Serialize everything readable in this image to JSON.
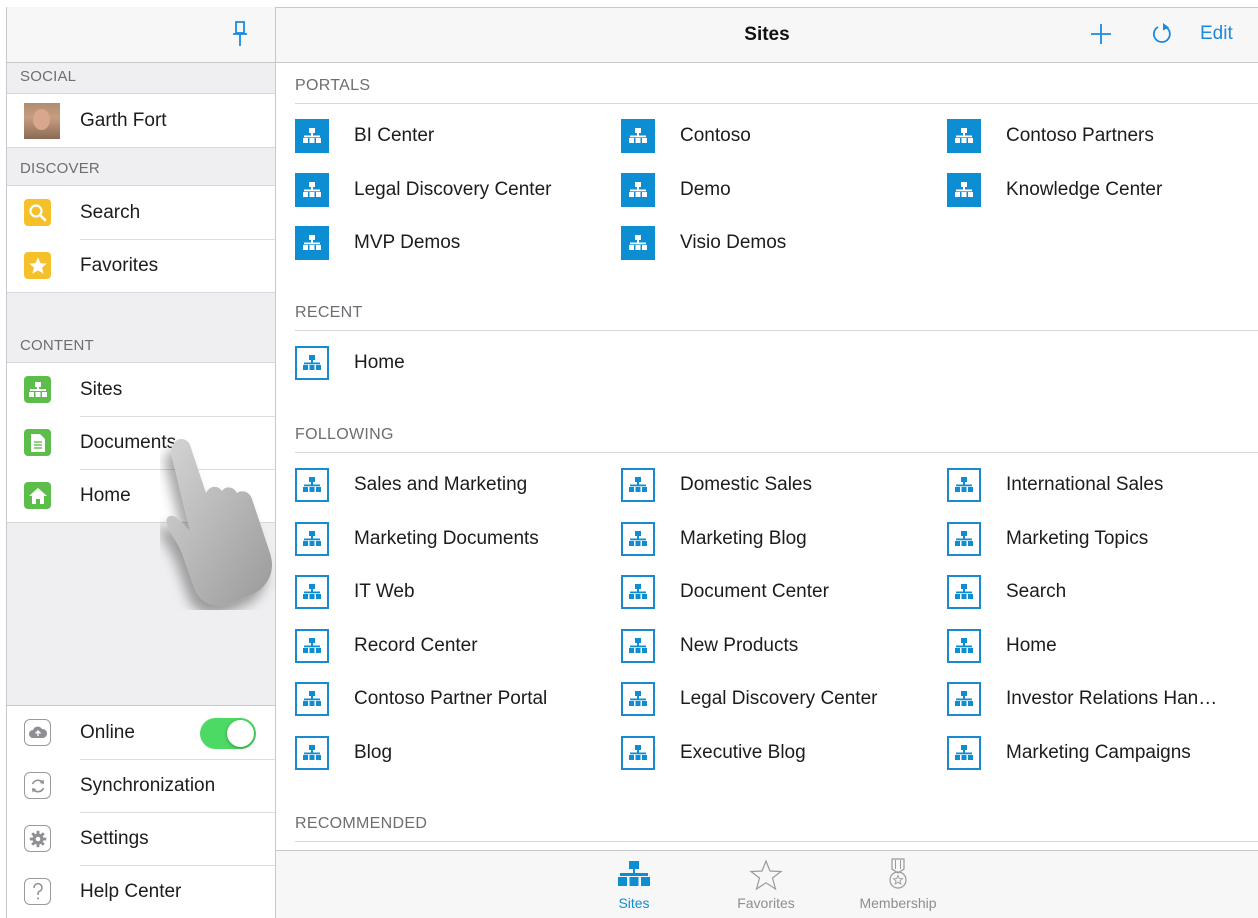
{
  "sidebar": {
    "sections": {
      "social": "SOCIAL",
      "discover": "DISCOVER",
      "content": "CONTENT"
    },
    "social_items": [
      {
        "label": "Garth Fort",
        "icon": "user-avatar"
      }
    ],
    "discover_items": [
      {
        "label": "Search",
        "icon": "search-icon"
      },
      {
        "label": "Favorites",
        "icon": "star-icon"
      }
    ],
    "content_items": [
      {
        "label": "Sites",
        "icon": "sites-icon"
      },
      {
        "label": "Documents",
        "icon": "document-icon"
      },
      {
        "label": "Home",
        "icon": "home-icon"
      }
    ],
    "bottom_items": [
      {
        "label": "Online",
        "icon": "cloud-icon",
        "toggle_on": true
      },
      {
        "label": "Synchronization",
        "icon": "sync-icon"
      },
      {
        "label": "Settings",
        "icon": "gear-icon"
      },
      {
        "label": "Help Center",
        "icon": "help-icon"
      }
    ]
  },
  "header": {
    "title": "Sites",
    "edit_label": "Edit"
  },
  "sections": {
    "portals": "PORTALS",
    "recent": "RECENT",
    "following": "FOLLOWING",
    "recommended": "RECOMMENDED"
  },
  "portals": [
    "BI Center",
    "Contoso",
    "Contoso Partners",
    "Legal Discovery Center",
    "Demo",
    "Knowledge Center",
    "MVP Demos",
    "Visio Demos"
  ],
  "recent": [
    "Home"
  ],
  "following": [
    "Sales and Marketing",
    "Domestic Sales",
    "International Sales",
    "Marketing Documents",
    "Marketing Blog",
    "Marketing Topics",
    "IT Web",
    "Document Center",
    "Search",
    "Record Center",
    "New Products",
    "Home",
    "Contoso Partner Portal",
    "Legal Discovery Center",
    "Investor Relations Han…",
    "Blog",
    "Executive Blog",
    "Marketing Campaigns"
  ],
  "tabs": [
    {
      "label": "Sites",
      "active": true
    },
    {
      "label": "Favorites",
      "active": false
    },
    {
      "label": "Membership",
      "active": false
    }
  ],
  "colors": {
    "accent": "#0e8ed2",
    "toggle_on": "#4cd964",
    "search_icon": "#f4c12a",
    "content_icon": "#5cbd4b"
  }
}
